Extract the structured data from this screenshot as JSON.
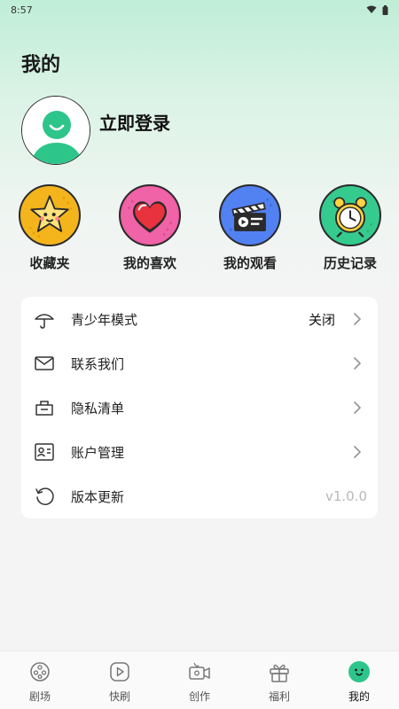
{
  "status_bar": {
    "time": "8:57"
  },
  "header": {
    "title": "我的"
  },
  "profile": {
    "login_label": "立即登录"
  },
  "shortcuts": [
    {
      "label": "收藏夹",
      "icon": "star-icon"
    },
    {
      "label": "我的喜欢",
      "icon": "heart-icon"
    },
    {
      "label": "我的观看",
      "icon": "clapperboard-icon"
    },
    {
      "label": "历史记录",
      "icon": "alarm-clock-icon"
    }
  ],
  "settings": [
    {
      "label": "青少年模式",
      "value": "关闭",
      "icon": "umbrella-icon"
    },
    {
      "label": "联系我们",
      "icon": "mail-icon"
    },
    {
      "label": "隐私清单",
      "icon": "privacy-list-icon"
    },
    {
      "label": "账户管理",
      "icon": "account-card-icon"
    },
    {
      "label": "版本更新",
      "value": "v1.0.0",
      "icon": "refresh-icon"
    }
  ],
  "tabbar": [
    {
      "label": "剧场",
      "icon": "film-reel-icon"
    },
    {
      "label": "快刷",
      "icon": "play-icon"
    },
    {
      "label": "创作",
      "icon": "camera-create-icon"
    },
    {
      "label": "福利",
      "icon": "gift-icon"
    },
    {
      "label": "我的",
      "icon": "face-icon",
      "active": true
    }
  ],
  "colors": {
    "accent": "#2ec58a",
    "gradient_top": "#bfeed7",
    "background": "#f4f4f4"
  }
}
